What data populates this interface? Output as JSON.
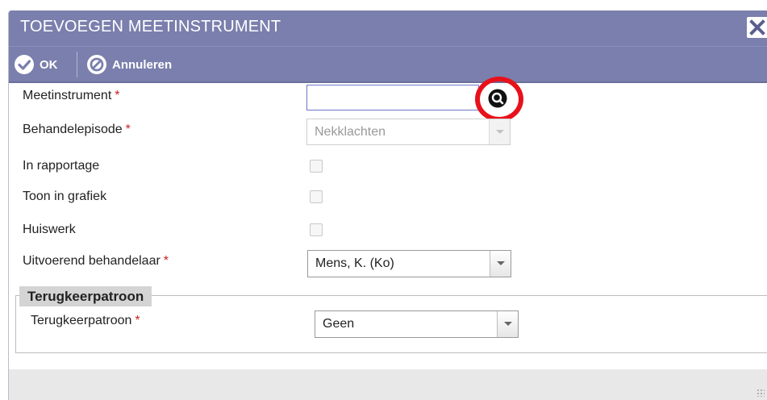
{
  "dialog": {
    "title": "TOEVOEGEN MEETINSTRUMENT",
    "close_icon": "close-icon"
  },
  "toolbar": {
    "ok_label": "OK",
    "ok_icon": "check-circle-icon",
    "cancel_label": "Annuleren",
    "cancel_icon": "cancel-circle-icon"
  },
  "form": {
    "meetinstrument": {
      "label": "Meetinstrument",
      "required": "*",
      "value": "",
      "search_icon": "search-icon"
    },
    "behandelepisode": {
      "label": "Behandelepisode",
      "required": "*",
      "selected": "Nekklachten",
      "disabled": true
    },
    "in_rapportage": {
      "label": "In rapportage",
      "checked": false
    },
    "toon_in_grafiek": {
      "label": "Toon in grafiek",
      "checked": false
    },
    "huiswerk": {
      "label": "Huiswerk",
      "checked": false
    },
    "uitvoerend_behandelaar": {
      "label": "Uitvoerend behandelaar",
      "required": "*",
      "selected": "Mens, K. (Ko)"
    }
  },
  "terugkeerpatroon_section": {
    "legend": "Terugkeerpatroon",
    "field": {
      "label": "Terugkeerpatroon",
      "required": "*",
      "selected": "Geen"
    }
  },
  "colors": {
    "header": "#7a7fad",
    "required": "#d02020",
    "highlight": "#e8111b",
    "input_border": "#6d77c9"
  }
}
